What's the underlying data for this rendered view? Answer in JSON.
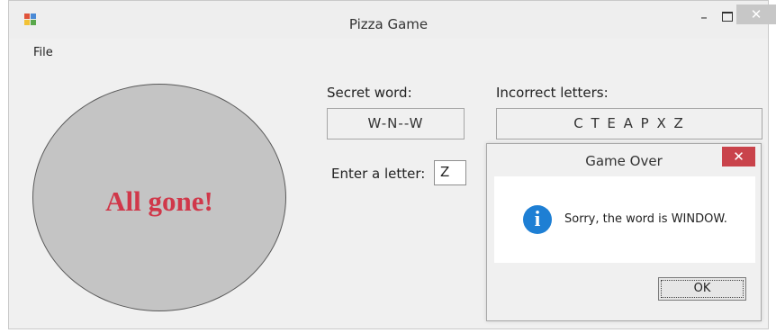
{
  "window": {
    "title": "Pizza Game",
    "controls": {
      "minimize": "–",
      "close": "✕"
    }
  },
  "menu": {
    "file": "File"
  },
  "pizza": {
    "text": "All gone!",
    "text_color": "#d0384a",
    "fill_color": "#c4c4c4"
  },
  "secret_word": {
    "label": "Secret word:",
    "value": "W-N--W"
  },
  "incorrect_letters": {
    "label": "Incorrect letters:",
    "value": "C T E A P X Z"
  },
  "enter_letter": {
    "label": "Enter a letter:",
    "value": "Z"
  },
  "dialog": {
    "title": "Game Over",
    "close": "✕",
    "icon": "info-icon",
    "message": "Sorry, the word is WINDOW.",
    "ok_label": "OK"
  },
  "colors": {
    "dialog_close": "#c9434b",
    "info_icon": "#1e7fd4",
    "window_bg": "#f0f0f0"
  }
}
